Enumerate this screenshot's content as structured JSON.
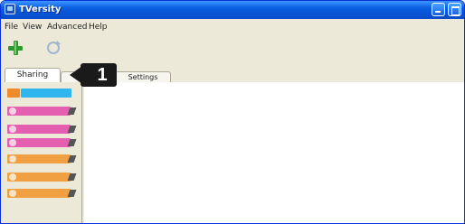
{
  "titlebar": {
    "title": "TVersity"
  },
  "menu": {
    "items": [
      "File",
      "View",
      "Advanced",
      "Help"
    ]
  },
  "toolbar": {
    "add_icon": "add-green-plus-icon",
    "refresh_icon": "refresh-icon"
  },
  "tabs": {
    "sharing": "Sharing",
    "settings": "Settings"
  },
  "callout": {
    "number": "1"
  },
  "sidebar": {
    "items": [
      {
        "label": "",
        "color": "#2fb6ee",
        "accent": "#f08a2a"
      },
      {
        "label": "",
        "color": "#e45fb0"
      },
      {
        "label": "",
        "color": "#e45fb0"
      },
      {
        "label": "",
        "color": "#e45fb0"
      },
      {
        "label": "",
        "color": "#f0a040"
      },
      {
        "label": "",
        "color": "#f0a040"
      },
      {
        "label": "",
        "color": "#f0a040"
      }
    ]
  },
  "colors": {
    "titlebar": "#0a5ee0",
    "window_bg": "#ece9d8",
    "content_bg": "#ffffff",
    "callout_bg": "#1a1a1a"
  }
}
